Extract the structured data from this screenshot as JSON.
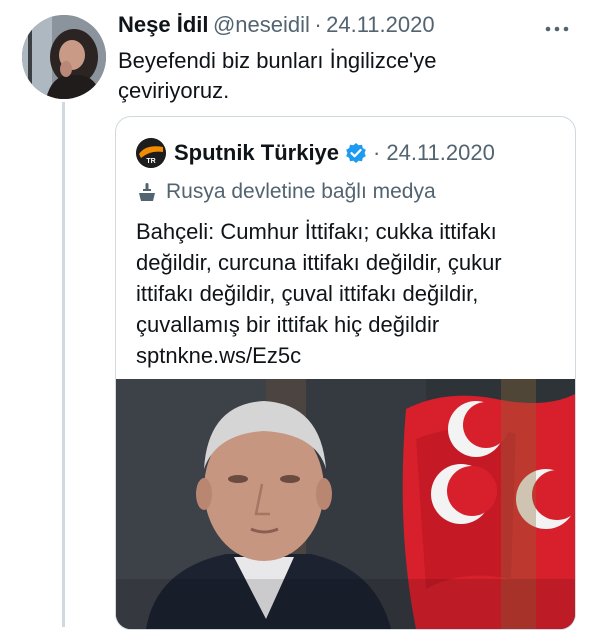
{
  "tweet": {
    "display_name": "Neşe İdil",
    "handle": "@neseidil",
    "separator": "·",
    "date": "24.11.2020",
    "more_icon": "more-dots-icon",
    "text_line1": "Beyefendi biz bunları İngilizce'ye",
    "text_line2": "çeviriyoruz."
  },
  "quote": {
    "display_name": "Sputnik Türkiye",
    "verified_icon": "verified-badge-icon",
    "separator": "·",
    "date": "24.11.2020",
    "label_icon": "podium-icon",
    "label": "Rusya devletine bağlı medya",
    "logo_text": "TR",
    "text_lines": [
      "Bahçeli: Cumhur İttifakı; cukka ittifakı",
      "değildir, curcuna ittifakı değildir, çukur",
      "ittifakı değildir, çuval ittifakı değildir,",
      "çuvallamış bir ittifak hiç değildir"
    ],
    "link": "sptnkne.ws/Ez5c"
  },
  "colors": {
    "text": "#0f1419",
    "secondary": "#536471",
    "verified": "#1d9bf0",
    "border": "#cfd9de",
    "flag_red": "#d8202c"
  }
}
